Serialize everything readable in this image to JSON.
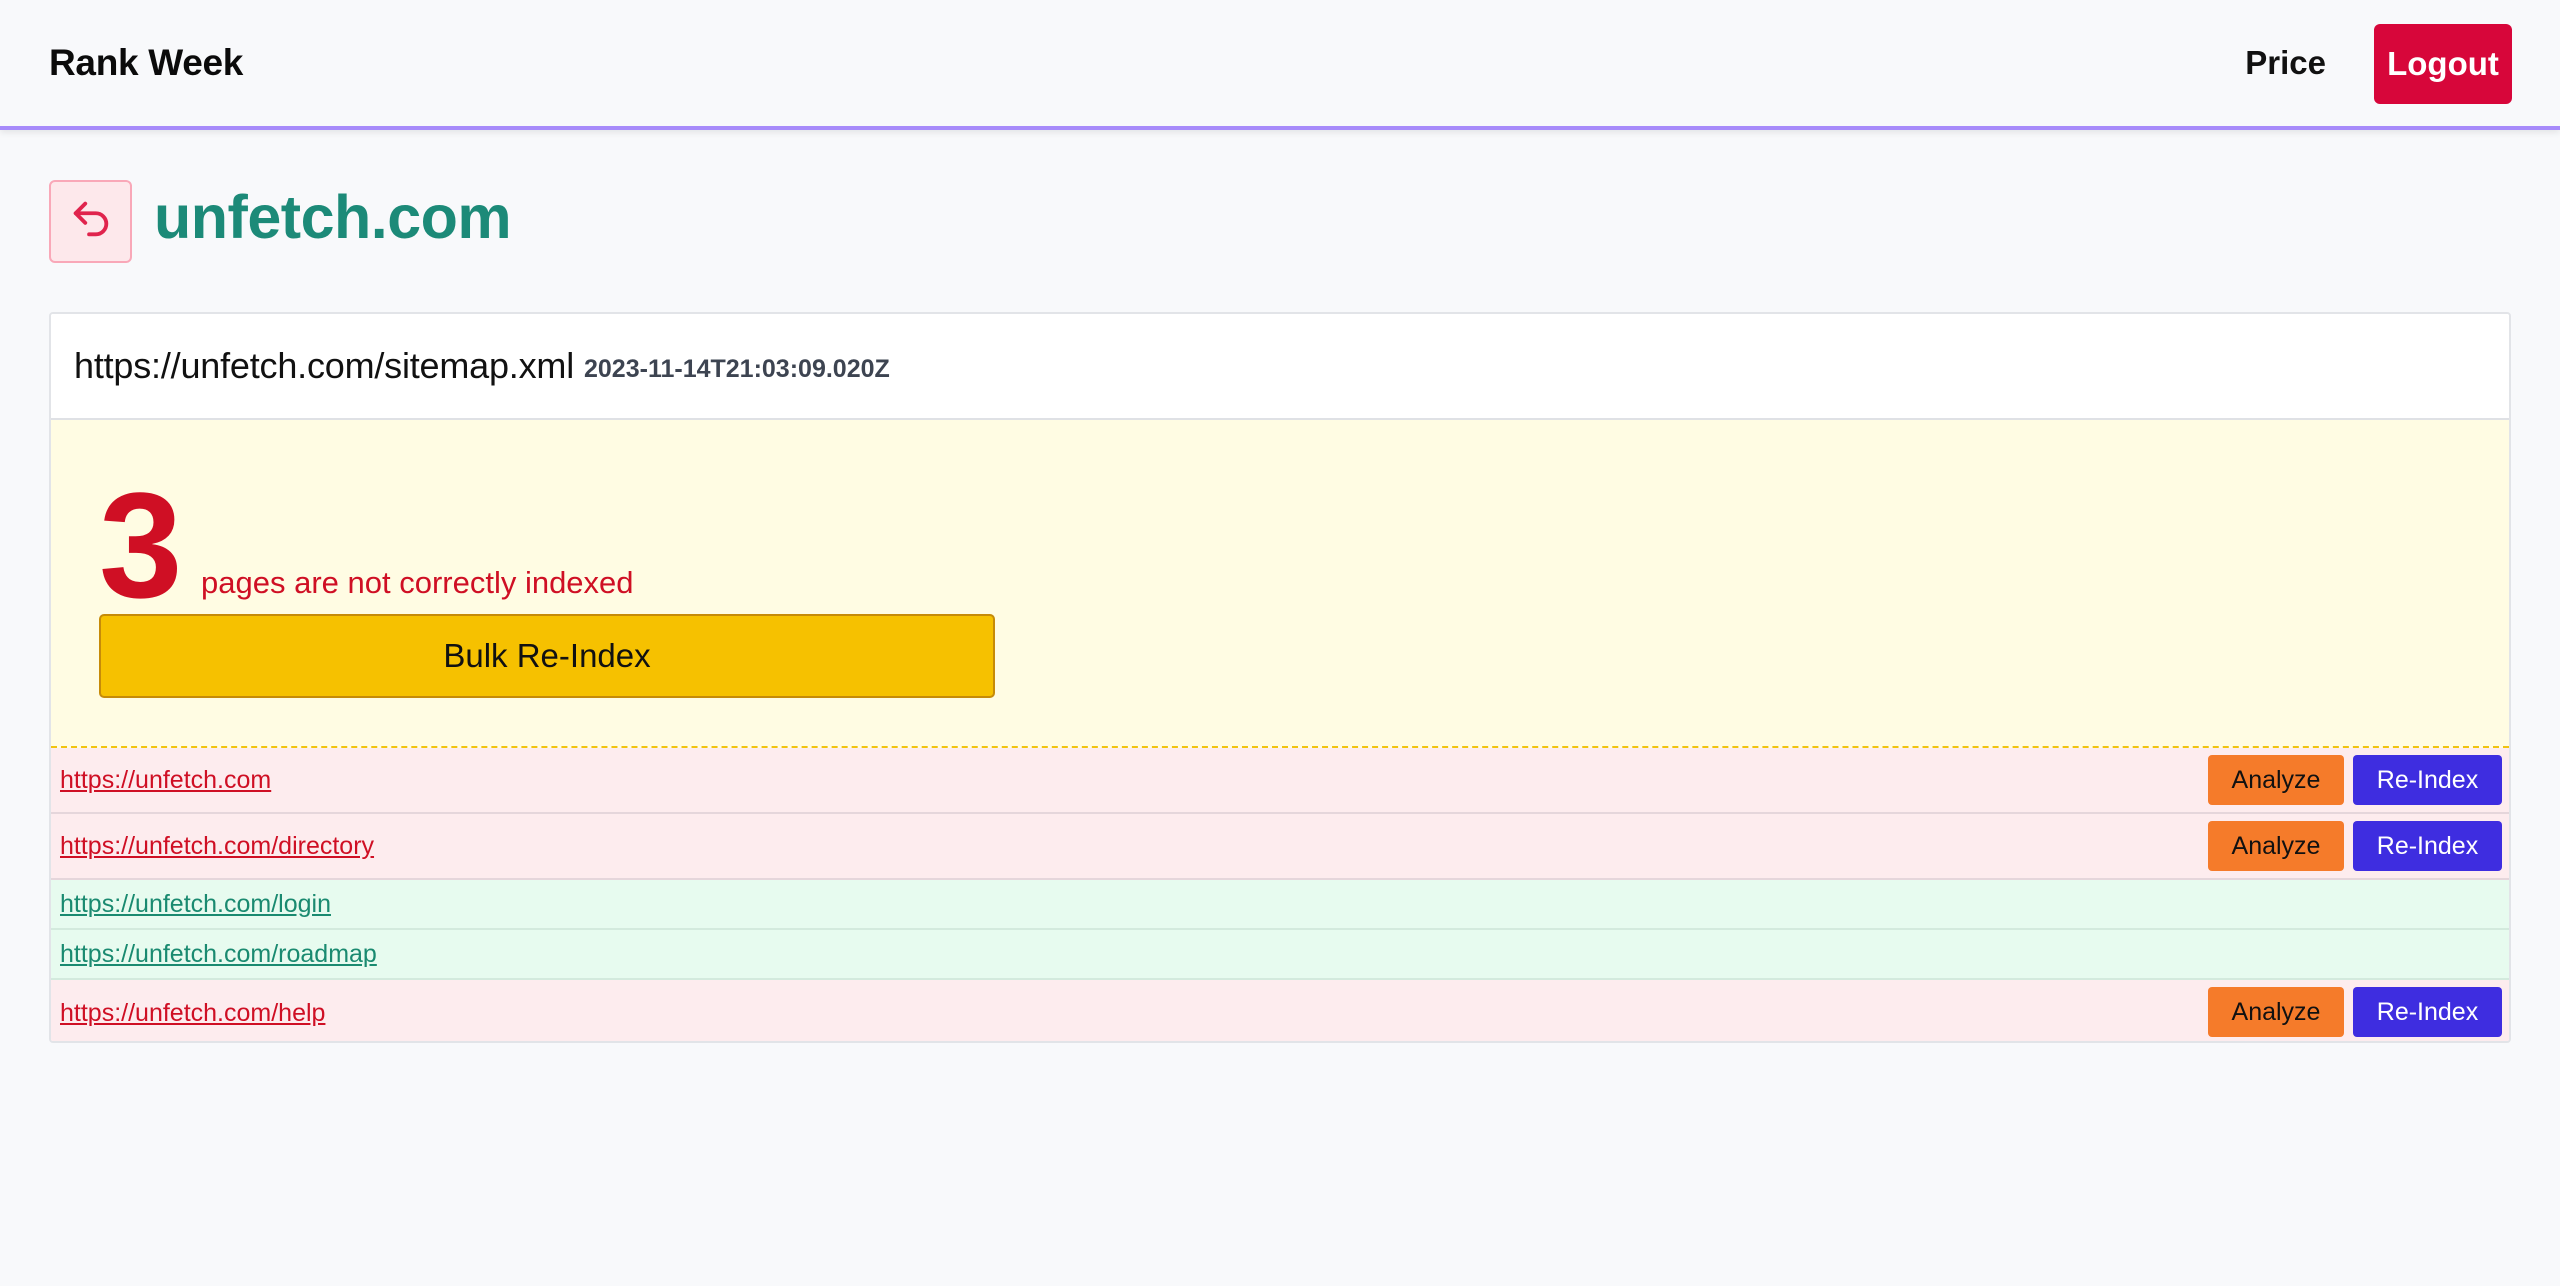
{
  "header": {
    "brand": "Rank Week",
    "nav_price": "Price",
    "logout_label": "Logout",
    "accent_color": "#a78bfa",
    "logout_color": "#d7063a"
  },
  "page": {
    "title": "unfetch.com",
    "back_icon": "undo-arrow-icon"
  },
  "sitemap": {
    "url": "https://unfetch.com/sitemap.xml",
    "date": "2023-11-14T21:03:09.020Z"
  },
  "alert": {
    "count": "3",
    "message": "pages are not correctly indexed",
    "bulk_label": "Bulk Re-Index"
  },
  "rows": [
    {
      "url": "https://unfetch.com",
      "status": "not-indexed",
      "analyze_label": "Analyze",
      "reindex_label": "Re-Index"
    },
    {
      "url": "https://unfetch.com/directory",
      "status": "not-indexed",
      "analyze_label": "Analyze",
      "reindex_label": "Re-Index"
    },
    {
      "url": "https://unfetch.com/login",
      "status": "indexed"
    },
    {
      "url": "https://unfetch.com/roadmap",
      "status": "indexed"
    },
    {
      "url": "https://unfetch.com/help",
      "status": "not-indexed",
      "analyze_label": "Analyze",
      "reindex_label": "Re-Index"
    }
  ]
}
